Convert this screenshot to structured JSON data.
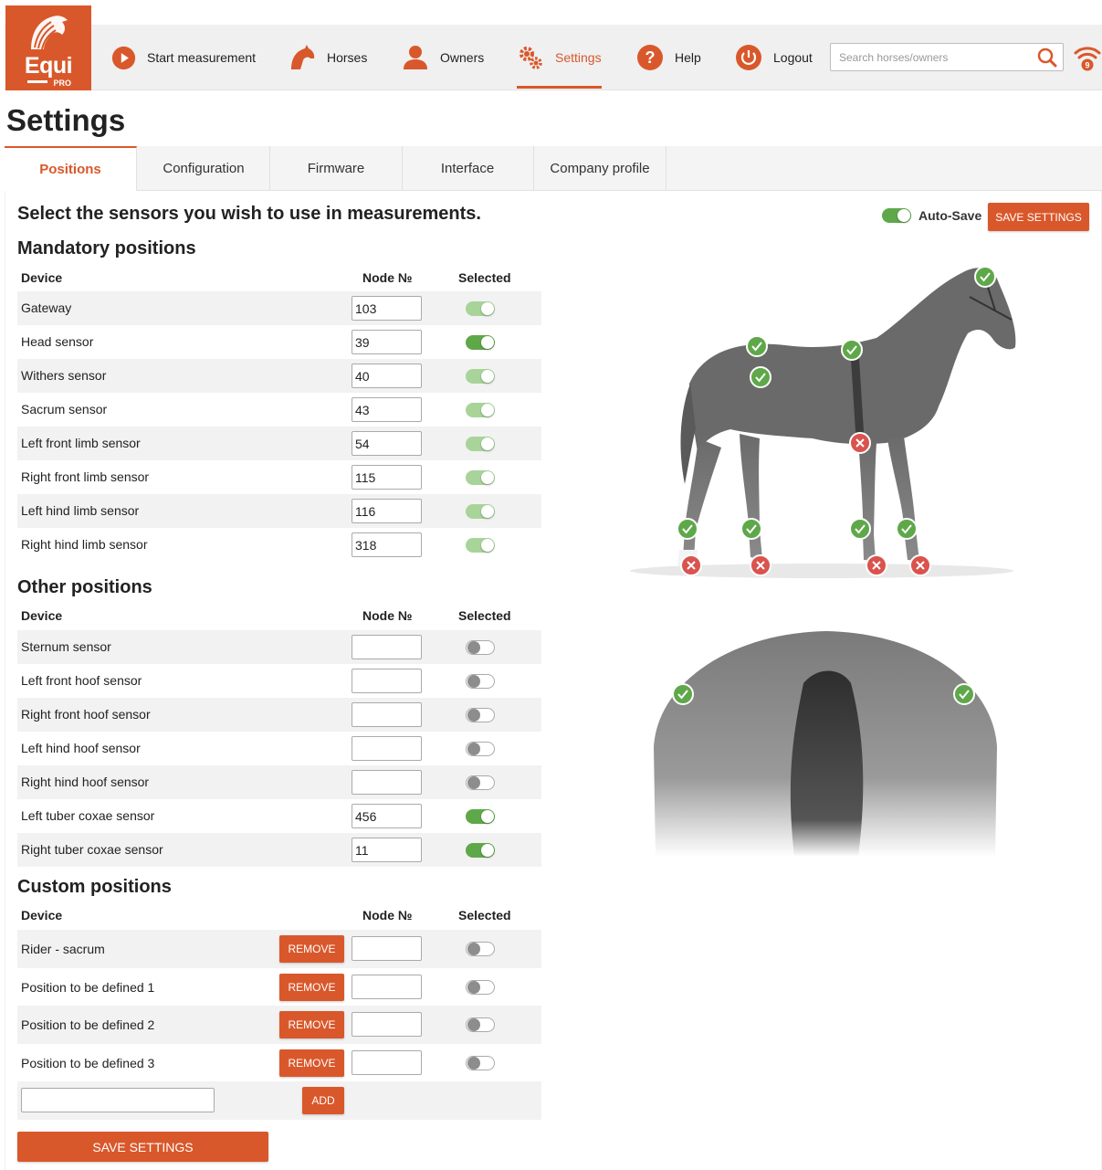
{
  "logo": {
    "name": "Equi",
    "sub": "PRO"
  },
  "nav": {
    "start_measurement": "Start measurement",
    "horses": "Horses",
    "owners": "Owners",
    "settings": "Settings",
    "help": "Help",
    "logout": "Logout",
    "search_placeholder": "Search horses/owners",
    "notification_count": "9"
  },
  "page_title": "Settings",
  "tabs": [
    "Positions",
    "Configuration",
    "Firmware",
    "Interface",
    "Company profile"
  ],
  "intro": "Select the sensors you wish to use in measurements.",
  "auto_save": {
    "label": "Auto-Save",
    "enabled": true
  },
  "save_settings_top": "SAVE SETTINGS",
  "save_settings_bottom": "SAVE SETTINGS",
  "columns": {
    "device": "Device",
    "node": "Node №",
    "selected": "Selected"
  },
  "mandatory": {
    "title": "Mandatory positions",
    "rows": [
      {
        "device": "Gateway",
        "node": "103",
        "selected": true
      },
      {
        "device": "Head sensor",
        "node": "39",
        "selected": true
      },
      {
        "device": "Withers sensor",
        "node": "40",
        "selected": true
      },
      {
        "device": "Sacrum sensor",
        "node": "43",
        "selected": true
      },
      {
        "device": "Left front limb sensor",
        "node": "54",
        "selected": true
      },
      {
        "device": "Right front limb sensor",
        "node": "115",
        "selected": true
      },
      {
        "device": "Left hind limb sensor",
        "node": "116",
        "selected": true
      },
      {
        "device": "Right hind limb sensor",
        "node": "318",
        "selected": true
      }
    ]
  },
  "other": {
    "title": "Other positions",
    "rows": [
      {
        "device": "Sternum sensor",
        "node": "",
        "selected": false
      },
      {
        "device": "Left front hoof sensor",
        "node": "",
        "selected": false
      },
      {
        "device": "Right front hoof sensor",
        "node": "",
        "selected": false
      },
      {
        "device": "Left hind hoof sensor",
        "node": "",
        "selected": false
      },
      {
        "device": "Right hind hoof sensor",
        "node": "",
        "selected": false
      },
      {
        "device": "Left tuber coxae sensor",
        "node": "456",
        "selected": true
      },
      {
        "device": "Right tuber coxae sensor",
        "node": "11",
        "selected": true
      }
    ]
  },
  "custom": {
    "title": "Custom positions",
    "remove_label": "REMOVE",
    "add_label": "ADD",
    "new_position_value": "",
    "rows": [
      {
        "device": "Rider - sacrum",
        "node": "",
        "selected": false
      },
      {
        "device": "Position to be defined 1",
        "node": "",
        "selected": false
      },
      {
        "device": "Position to be defined 2",
        "node": "",
        "selected": false
      },
      {
        "device": "Position to be defined 3",
        "node": "",
        "selected": false
      }
    ]
  },
  "colors": {
    "accent": "#d9582b",
    "toggle_on": "#5fa84a",
    "marker_ok": "#5fa84a",
    "marker_off": "#d9534f"
  }
}
